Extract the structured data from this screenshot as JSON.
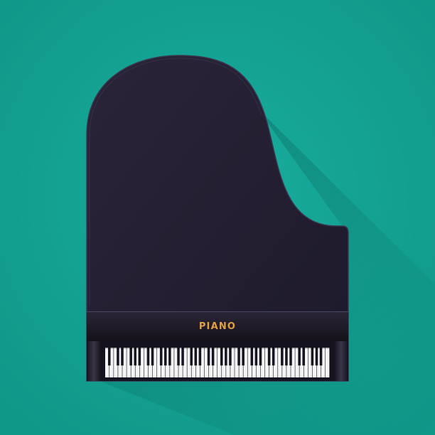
{
  "piano": {
    "brand_label": "PIANO",
    "white_key_count": 52
  },
  "colors": {
    "background": "#13a293",
    "shadow": "#0f8a7d",
    "body": "#231e33",
    "body_edge": "#343049",
    "keyboard_frame": "#15121f",
    "white_key": "#f4f4f4",
    "black_key": "#17141f",
    "brand_text": "#e0a040"
  }
}
